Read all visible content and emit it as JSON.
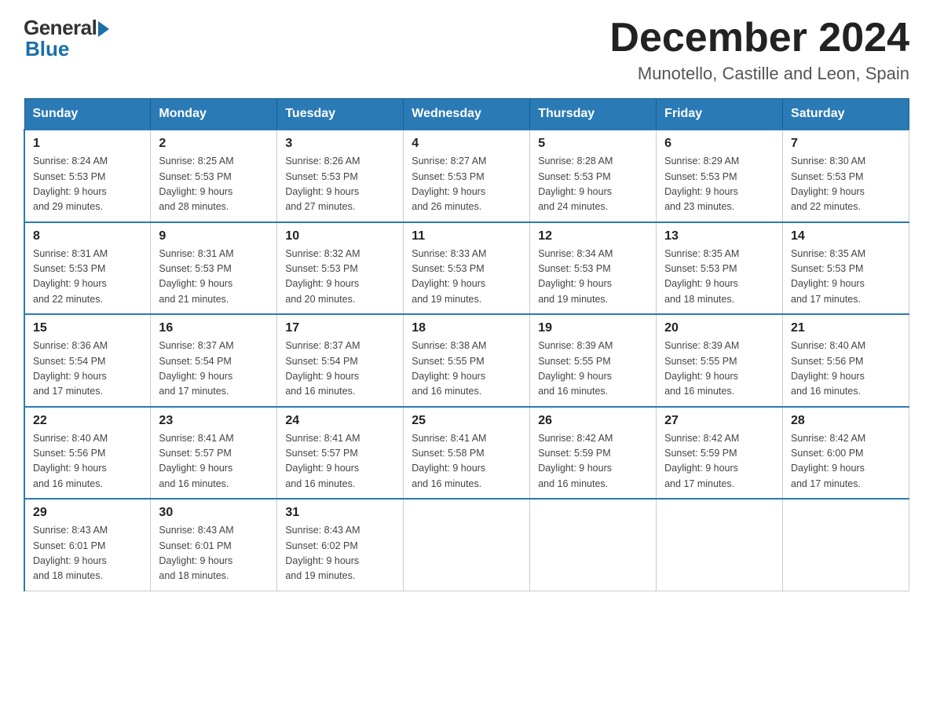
{
  "header": {
    "logo_general": "General",
    "logo_blue": "Blue",
    "month_title": "December 2024",
    "location": "Munotello, Castille and Leon, Spain"
  },
  "weekdays": [
    "Sunday",
    "Monday",
    "Tuesday",
    "Wednesday",
    "Thursday",
    "Friday",
    "Saturday"
  ],
  "weeks": [
    [
      {
        "day": "1",
        "sunrise": "8:24 AM",
        "sunset": "5:53 PM",
        "daylight": "9 hours and 29 minutes."
      },
      {
        "day": "2",
        "sunrise": "8:25 AM",
        "sunset": "5:53 PM",
        "daylight": "9 hours and 28 minutes."
      },
      {
        "day": "3",
        "sunrise": "8:26 AM",
        "sunset": "5:53 PM",
        "daylight": "9 hours and 27 minutes."
      },
      {
        "day": "4",
        "sunrise": "8:27 AM",
        "sunset": "5:53 PM",
        "daylight": "9 hours and 26 minutes."
      },
      {
        "day": "5",
        "sunrise": "8:28 AM",
        "sunset": "5:53 PM",
        "daylight": "9 hours and 24 minutes."
      },
      {
        "day": "6",
        "sunrise": "8:29 AM",
        "sunset": "5:53 PM",
        "daylight": "9 hours and 23 minutes."
      },
      {
        "day": "7",
        "sunrise": "8:30 AM",
        "sunset": "5:53 PM",
        "daylight": "9 hours and 22 minutes."
      }
    ],
    [
      {
        "day": "8",
        "sunrise": "8:31 AM",
        "sunset": "5:53 PM",
        "daylight": "9 hours and 22 minutes."
      },
      {
        "day": "9",
        "sunrise": "8:31 AM",
        "sunset": "5:53 PM",
        "daylight": "9 hours and 21 minutes."
      },
      {
        "day": "10",
        "sunrise": "8:32 AM",
        "sunset": "5:53 PM",
        "daylight": "9 hours and 20 minutes."
      },
      {
        "day": "11",
        "sunrise": "8:33 AM",
        "sunset": "5:53 PM",
        "daylight": "9 hours and 19 minutes."
      },
      {
        "day": "12",
        "sunrise": "8:34 AM",
        "sunset": "5:53 PM",
        "daylight": "9 hours and 19 minutes."
      },
      {
        "day": "13",
        "sunrise": "8:35 AM",
        "sunset": "5:53 PM",
        "daylight": "9 hours and 18 minutes."
      },
      {
        "day": "14",
        "sunrise": "8:35 AM",
        "sunset": "5:53 PM",
        "daylight": "9 hours and 17 minutes."
      }
    ],
    [
      {
        "day": "15",
        "sunrise": "8:36 AM",
        "sunset": "5:54 PM",
        "daylight": "9 hours and 17 minutes."
      },
      {
        "day": "16",
        "sunrise": "8:37 AM",
        "sunset": "5:54 PM",
        "daylight": "9 hours and 17 minutes."
      },
      {
        "day": "17",
        "sunrise": "8:37 AM",
        "sunset": "5:54 PM",
        "daylight": "9 hours and 16 minutes."
      },
      {
        "day": "18",
        "sunrise": "8:38 AM",
        "sunset": "5:55 PM",
        "daylight": "9 hours and 16 minutes."
      },
      {
        "day": "19",
        "sunrise": "8:39 AM",
        "sunset": "5:55 PM",
        "daylight": "9 hours and 16 minutes."
      },
      {
        "day": "20",
        "sunrise": "8:39 AM",
        "sunset": "5:55 PM",
        "daylight": "9 hours and 16 minutes."
      },
      {
        "day": "21",
        "sunrise": "8:40 AM",
        "sunset": "5:56 PM",
        "daylight": "9 hours and 16 minutes."
      }
    ],
    [
      {
        "day": "22",
        "sunrise": "8:40 AM",
        "sunset": "5:56 PM",
        "daylight": "9 hours and 16 minutes."
      },
      {
        "day": "23",
        "sunrise": "8:41 AM",
        "sunset": "5:57 PM",
        "daylight": "9 hours and 16 minutes."
      },
      {
        "day": "24",
        "sunrise": "8:41 AM",
        "sunset": "5:57 PM",
        "daylight": "9 hours and 16 minutes."
      },
      {
        "day": "25",
        "sunrise": "8:41 AM",
        "sunset": "5:58 PM",
        "daylight": "9 hours and 16 minutes."
      },
      {
        "day": "26",
        "sunrise": "8:42 AM",
        "sunset": "5:59 PM",
        "daylight": "9 hours and 16 minutes."
      },
      {
        "day": "27",
        "sunrise": "8:42 AM",
        "sunset": "5:59 PM",
        "daylight": "9 hours and 17 minutes."
      },
      {
        "day": "28",
        "sunrise": "8:42 AM",
        "sunset": "6:00 PM",
        "daylight": "9 hours and 17 minutes."
      }
    ],
    [
      {
        "day": "29",
        "sunrise": "8:43 AM",
        "sunset": "6:01 PM",
        "daylight": "9 hours and 18 minutes."
      },
      {
        "day": "30",
        "sunrise": "8:43 AM",
        "sunset": "6:01 PM",
        "daylight": "9 hours and 18 minutes."
      },
      {
        "day": "31",
        "sunrise": "8:43 AM",
        "sunset": "6:02 PM",
        "daylight": "9 hours and 19 minutes."
      },
      null,
      null,
      null,
      null
    ]
  ]
}
